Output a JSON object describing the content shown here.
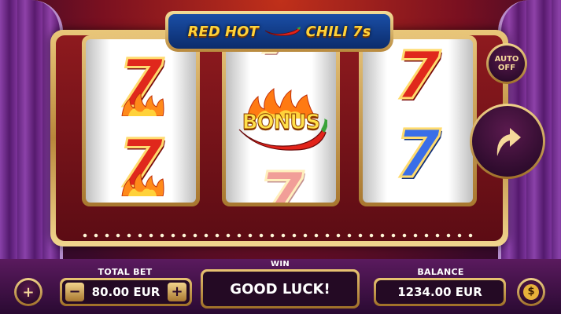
{
  "game": {
    "title_part1": "RED HOT",
    "title_part2": "CHILI 7s"
  },
  "reels": [
    {
      "symbols": [
        "7-red-flames",
        "7-red-flames"
      ]
    },
    {
      "symbols": [
        "7-faded",
        "BONUS",
        "7-faded"
      ],
      "bonus_label": "BONUS"
    },
    {
      "symbols": [
        "7-red",
        "7-blue"
      ]
    }
  ],
  "controls": {
    "auto_label_1": "AUTO",
    "auto_label_2": "OFF",
    "spin_icon": "curved-arrow-icon",
    "menu_icon": "plus-icon",
    "coin_icon": "dollar-coin-icon",
    "coin_symbol": "$"
  },
  "bet": {
    "label": "TOTAL BET",
    "value": "80.00 EUR",
    "minus": "−",
    "plus": "+"
  },
  "win": {
    "label": "WIN",
    "message": "GOOD LUCK!"
  },
  "balance": {
    "label": "BALANCE",
    "value": "1234.00 EUR"
  },
  "menu_plus": "+"
}
